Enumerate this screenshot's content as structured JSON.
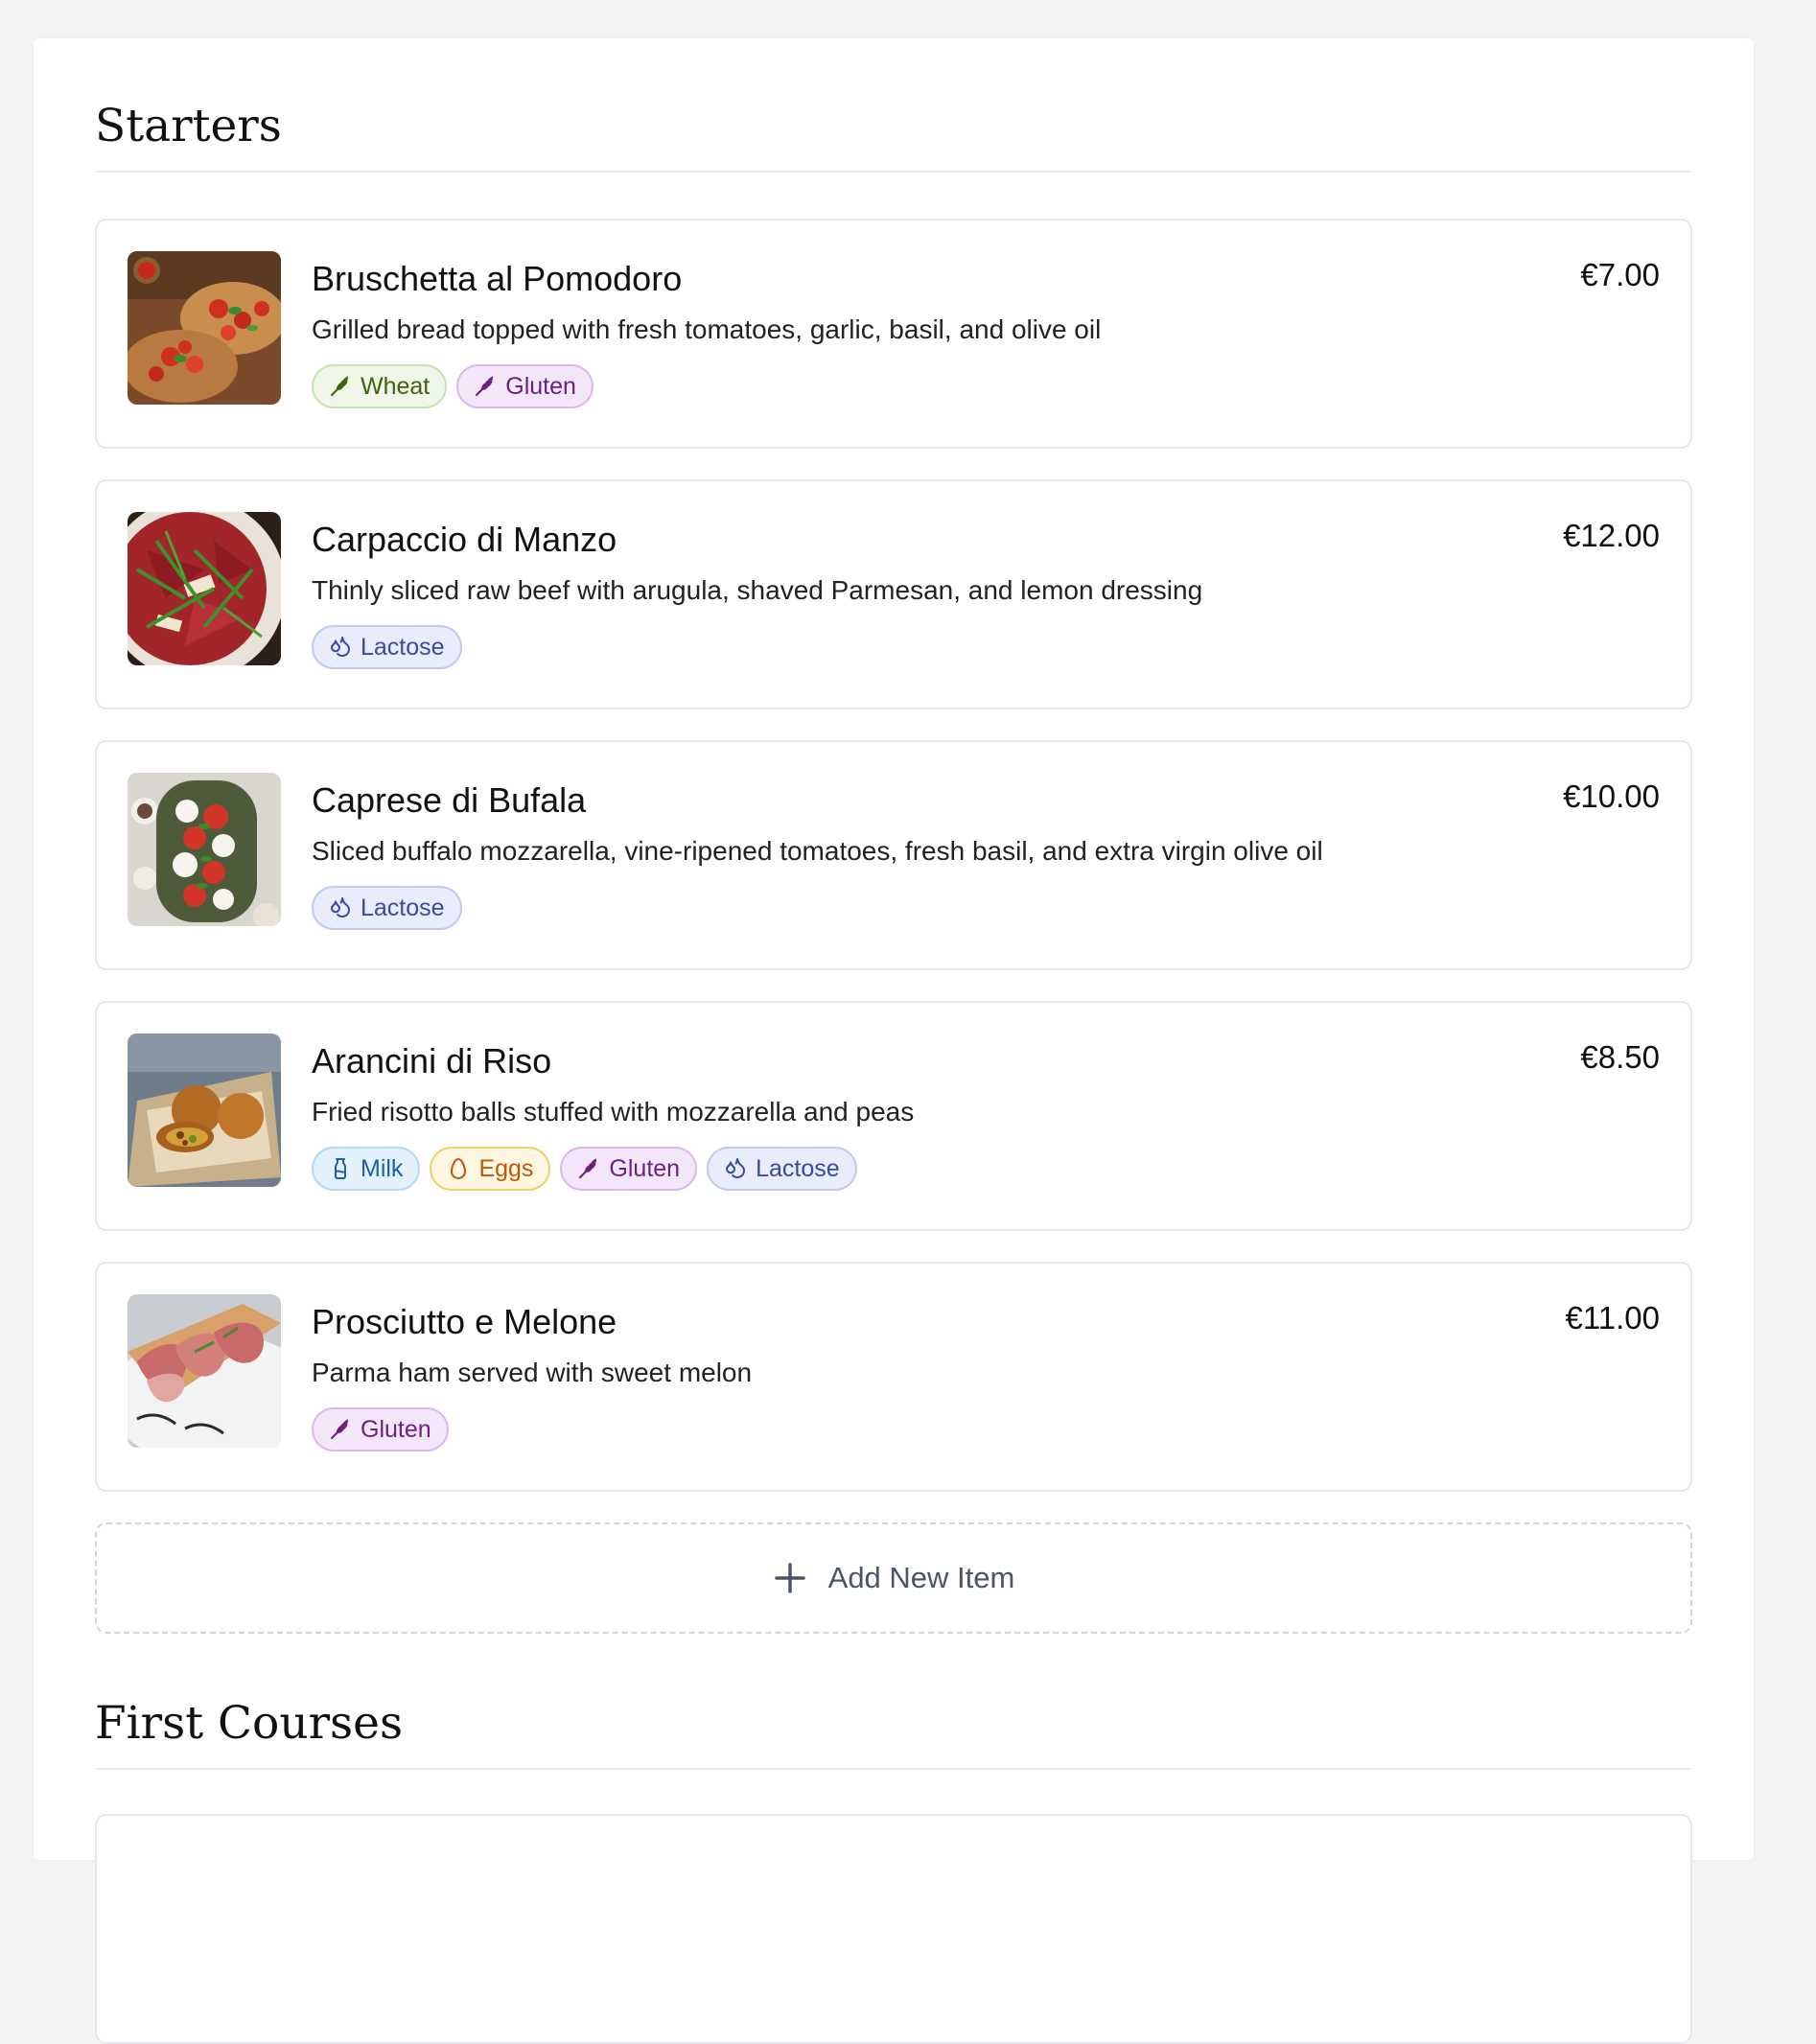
{
  "sections": [
    {
      "title": "Starters",
      "items": [
        {
          "name": "Bruschetta al Pomodoro",
          "price": "€7.00",
          "description": "Grilled bread topped with fresh tomatoes, garlic, basil, and olive oil",
          "tags": [
            {
              "label": "Wheat",
              "icon": "wheat-icon"
            },
            {
              "label": "Gluten",
              "icon": "wheat-icon"
            }
          ]
        },
        {
          "name": "Carpaccio di Manzo",
          "price": "€12.00",
          "description": "Thinly sliced raw beef with arugula, shaved Parmesan, and lemon dressing",
          "tags": [
            {
              "label": "Lactose",
              "icon": "droplets-icon"
            }
          ]
        },
        {
          "name": "Caprese di Bufala",
          "price": "€10.00",
          "description": "Sliced buffalo mozzarella, vine-ripened tomatoes, fresh basil, and extra virgin olive oil",
          "tags": [
            {
              "label": "Lactose",
              "icon": "droplets-icon"
            }
          ]
        },
        {
          "name": "Arancini di Riso",
          "price": "€8.50",
          "description": "Fried risotto balls stuffed with mozzarella and peas",
          "tags": [
            {
              "label": "Milk",
              "icon": "milk-bottle-icon"
            },
            {
              "label": "Eggs",
              "icon": "egg-icon"
            },
            {
              "label": "Gluten",
              "icon": "wheat-icon"
            },
            {
              "label": "Lactose",
              "icon": "droplets-icon"
            }
          ]
        },
        {
          "name": "Prosciutto e Melone",
          "price": "€11.00",
          "description": "Parma ham served with sweet melon",
          "tags": [
            {
              "label": "Gluten",
              "icon": "wheat-icon"
            }
          ]
        }
      ],
      "add_button_label": "Add New Item"
    },
    {
      "title": "First Courses"
    }
  ],
  "colors": {
    "wheat": "#3f6212",
    "gluten": "#6b2180",
    "lactose": "#3a4aa0",
    "milk": "#1f5fa3",
    "eggs": "#c2550c"
  }
}
